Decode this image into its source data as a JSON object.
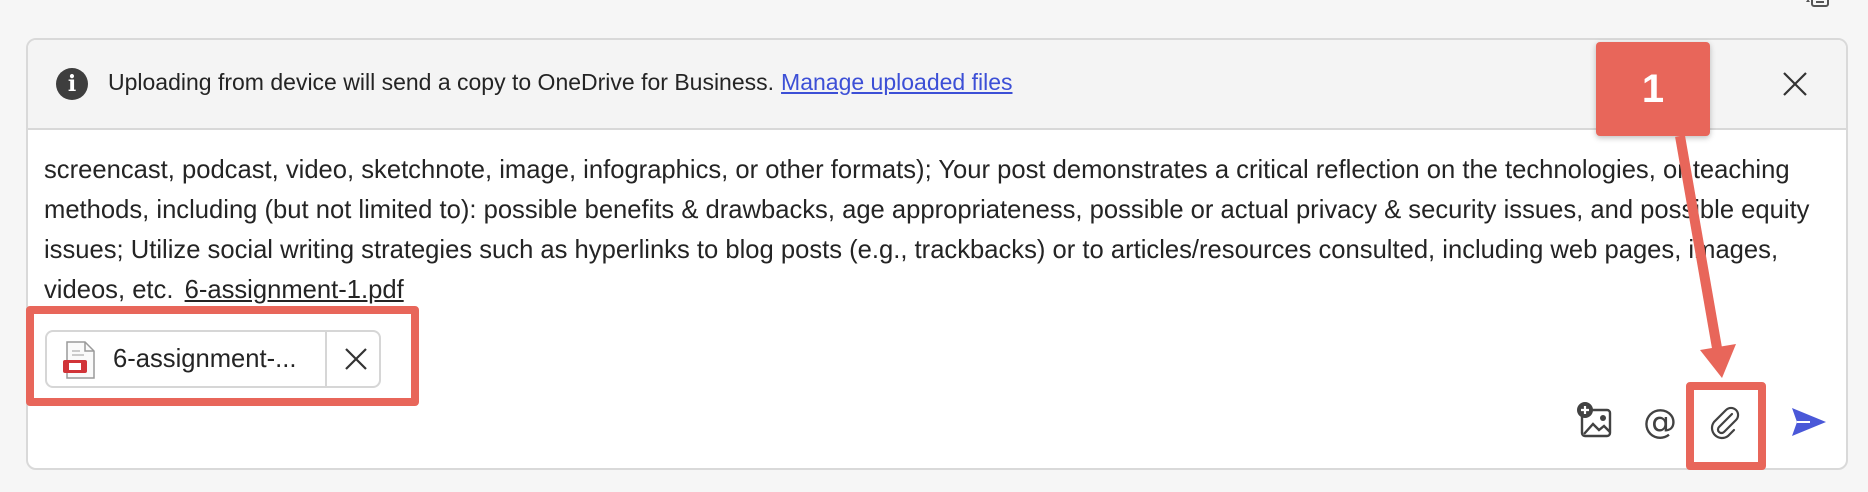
{
  "banner": {
    "info_icon": "info-icon",
    "text": "Uploading from device will send a copy to OneDrive for Business.",
    "link_text": "Manage uploaded files",
    "close_icon": "close-icon"
  },
  "message": {
    "body": "screencast, podcast, video, sketchnote, image, infographics, or other formats); Your post demonstrates a critical reflection on the technologies, or teaching methods, including (but not limited to): possible benefits & drawbacks, age appropriateness, possible or actual privacy & security issues, and possible equity issues; Utilize social writing strategies such as hyperlinks to blog posts (e.g., trackbacks) or to articles/resources consulted, including web pages, images, videos, etc.",
    "attachment_link": "6-assignment-1.pdf"
  },
  "attachment_chip": {
    "file_icon": "pdf-file-icon",
    "name": "6-assignment-...",
    "remove_icon": "close-icon"
  },
  "toolbar": {
    "image_icon": "add-image-icon",
    "mention_label": "@",
    "attach_icon": "paperclip-icon",
    "send_icon": "send-icon"
  },
  "annotation": {
    "badge": "1",
    "color": "#e8665a"
  },
  "colors": {
    "link": "#3c4fd6",
    "send": "#4a58d8",
    "text": "#242424"
  }
}
